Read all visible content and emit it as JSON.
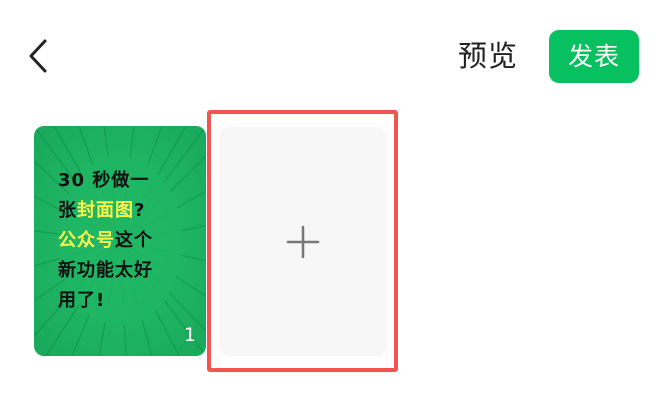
{
  "header": {
    "back_icon": "chevron-left-icon",
    "preview_label": "预览",
    "publish_label": "发表"
  },
  "cover": {
    "line1": "30 秒做一",
    "line2_a": "张",
    "line2_b": "封面图",
    "line2_c": "?",
    "line3_a": "公众号",
    "line3_b": "这个",
    "line4": "新功能太好",
    "line5": "用了!",
    "index": "1"
  },
  "add_slot": {
    "icon": "plus-icon"
  },
  "colors": {
    "accent": "#07c160",
    "highlight_border": "#f15451",
    "cover_bg": "#1fb664",
    "cover_highlight": "#fff34a"
  }
}
